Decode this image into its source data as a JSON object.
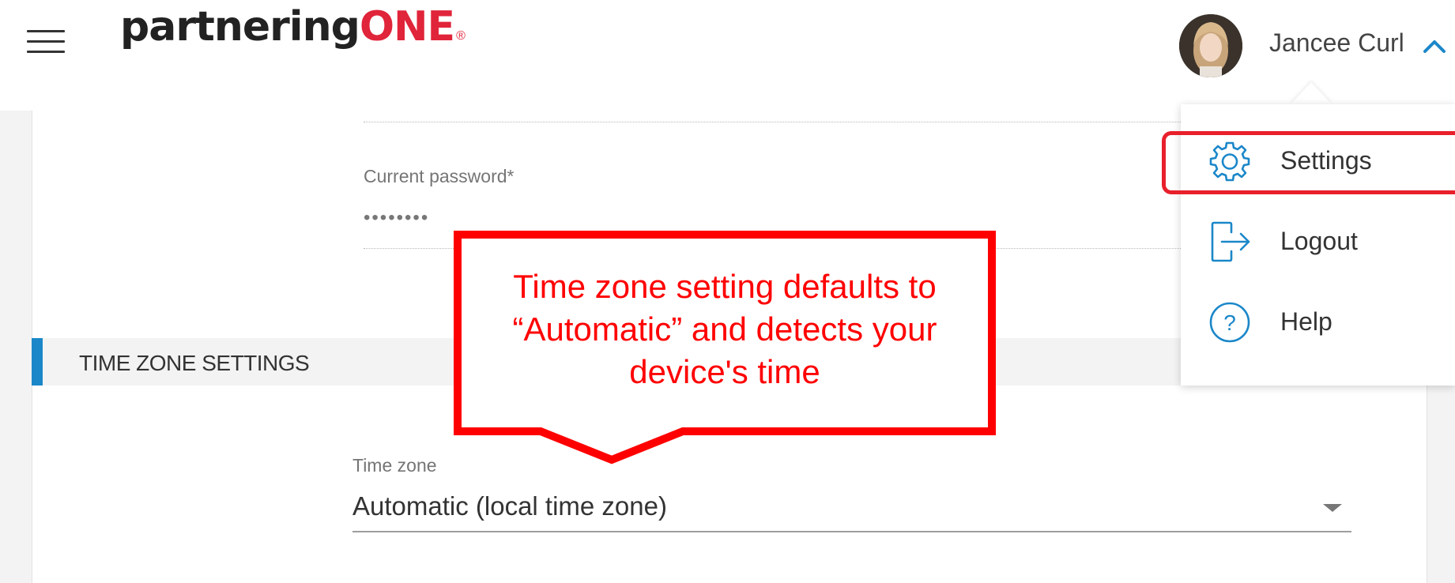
{
  "header": {
    "logo_main": "partnering",
    "logo_accent": "ONE",
    "logo_reg": "®",
    "user_name": "Jancee Curl"
  },
  "form": {
    "current_password_label": "Current password*",
    "current_password_value": "••••••••",
    "section_title": "TIME ZONE SETTINGS",
    "time_zone_label": "Time zone",
    "time_zone_value": "Automatic (local time zone)"
  },
  "user_menu": {
    "items": [
      {
        "label": "Settings",
        "icon": "gear-icon"
      },
      {
        "label": "Logout",
        "icon": "logout-icon"
      },
      {
        "label": "Help",
        "icon": "help-icon"
      }
    ]
  },
  "annotation": {
    "callout_text": "Time zone setting defaults to “Automatic” and detects your device's time"
  },
  "colors": {
    "accent_blue": "#1b87c9",
    "brand_red": "#e0243a",
    "annotation_red": "#ff0000"
  }
}
